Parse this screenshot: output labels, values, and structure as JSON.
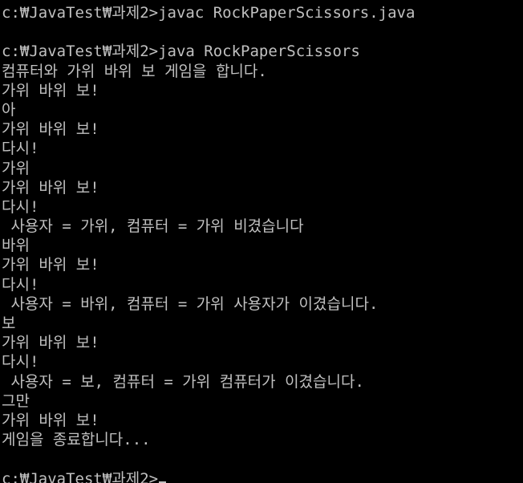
{
  "console": {
    "lines": [
      "c:₩JavaTest₩과제2>javac RockPaperScissors.java",
      "",
      "c:₩JavaTest₩과제2>java RockPaperScissors",
      "컴퓨터와 가위 바위 보 게임을 합니다.",
      "가위 바위 보!",
      "아",
      "가위 바위 보!",
      "다시!",
      "가위",
      "가위 바위 보!",
      "다시!",
      " 사용자 = 가위, 컴퓨터 = 가위 비겼습니다",
      "바위",
      "가위 바위 보!",
      "다시!",
      " 사용자 = 바위, 컴퓨터 = 가위 사용자가 이겼습니다.",
      "보",
      "가위 바위 보!",
      "다시!",
      " 사용자 = 보, 컴퓨터 = 가위 컴퓨터가 이겼습니다.",
      "그만",
      "가위 바위 보!",
      "게임을 종료합니다...",
      "",
      "c:₩JavaTest₩과제2>"
    ]
  },
  "colors": {
    "background": "#000000",
    "text": "#c0c0c0"
  }
}
